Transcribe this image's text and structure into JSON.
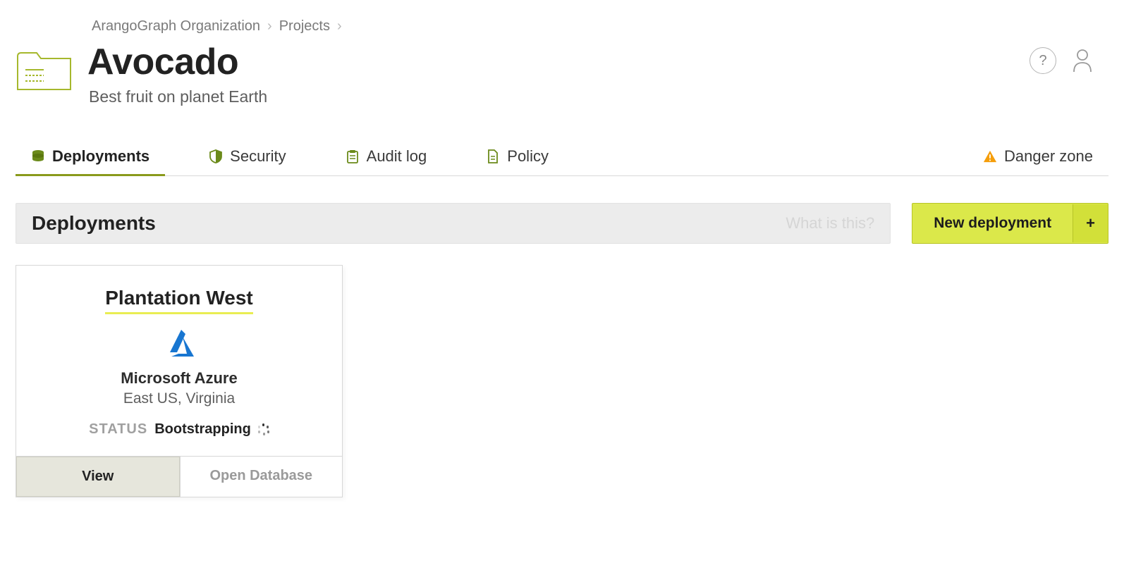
{
  "breadcrumb": {
    "org": "ArangoGraph Organization",
    "projects": "Projects"
  },
  "header": {
    "title": "Avocado",
    "subtitle": "Best fruit on planet Earth"
  },
  "tabs": {
    "deployments": "Deployments",
    "security": "Security",
    "audit": "Audit log",
    "policy": "Policy",
    "danger": "Danger zone"
  },
  "section": {
    "title": "Deployments",
    "hint": "What is this?",
    "new_label": "New deployment"
  },
  "card": {
    "name": "Plantation West",
    "provider": "Microsoft Azure",
    "region": "East US, Virginia",
    "status_label": "STATUS",
    "status_value": "Bootstrapping",
    "view": "View",
    "open": "Open Database"
  }
}
